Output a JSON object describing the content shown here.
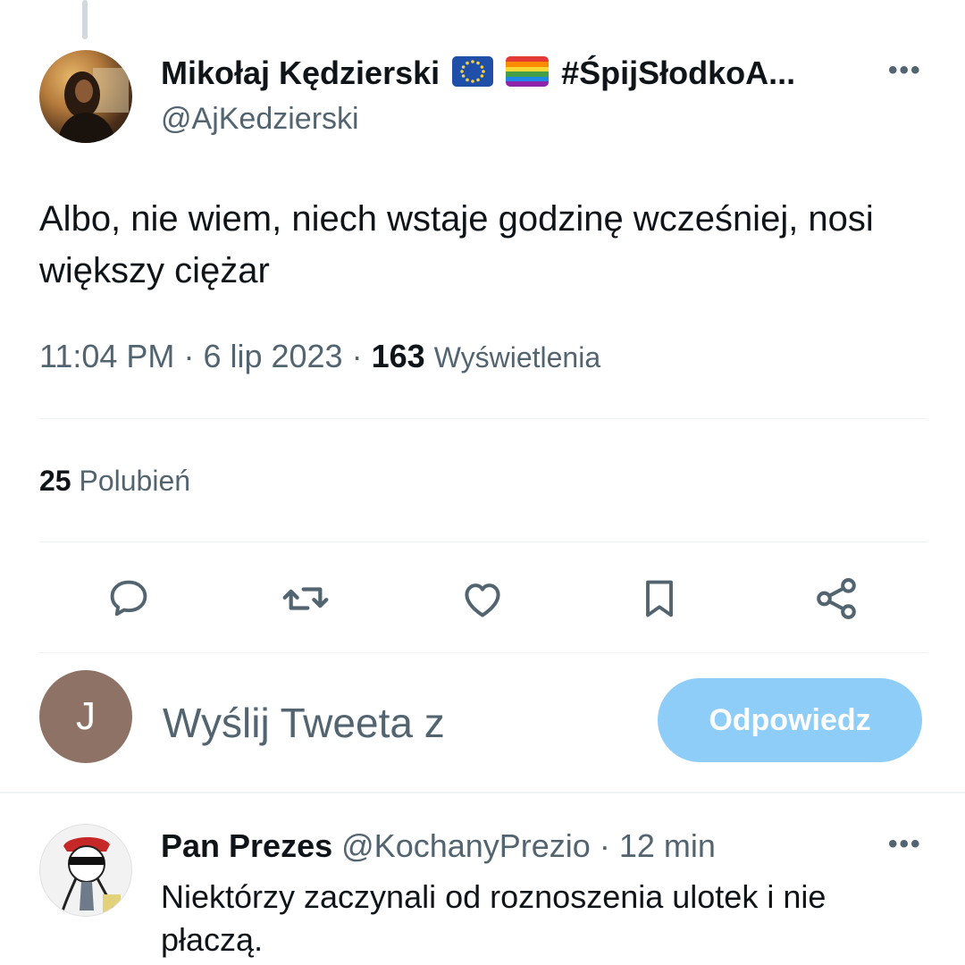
{
  "tweet": {
    "author_name": "Mikołaj Kędzierski",
    "author_hashtag": "#ŚpijSłodkoA...",
    "author_handle": "@AjKedzierski",
    "text": "Albo, nie wiem, niech wstaje godzinę wcześniej, nosi większy ciężar",
    "time": "11:04 PM",
    "date": "6 lip 2023",
    "views_count": "163",
    "views_label": "Wyświetlenia",
    "likes_count": "25",
    "likes_label": "Polubień",
    "more_glyph": "•••"
  },
  "actions": [
    {
      "icon": "comment-icon"
    },
    {
      "icon": "retweet-icon"
    },
    {
      "icon": "heart-icon"
    },
    {
      "icon": "bookmark-icon"
    },
    {
      "icon": "share-icon"
    }
  ],
  "compose": {
    "avatar_initial": "J",
    "placeholder": "Wyślij Tweeta z",
    "reply_button": "Odpowiedz"
  },
  "reply_tweet": {
    "name": "Pan Prezes",
    "handle": "@KochanyPrezio",
    "time": "12 min",
    "text": "Niektórzy zaczynali od roznoszenia ulotek i nie płaczą."
  },
  "colors": {
    "text_primary": "#0f1419",
    "text_secondary": "#536471",
    "reply_button_bg": "#8ecdf8",
    "divider": "#eff3f4"
  }
}
